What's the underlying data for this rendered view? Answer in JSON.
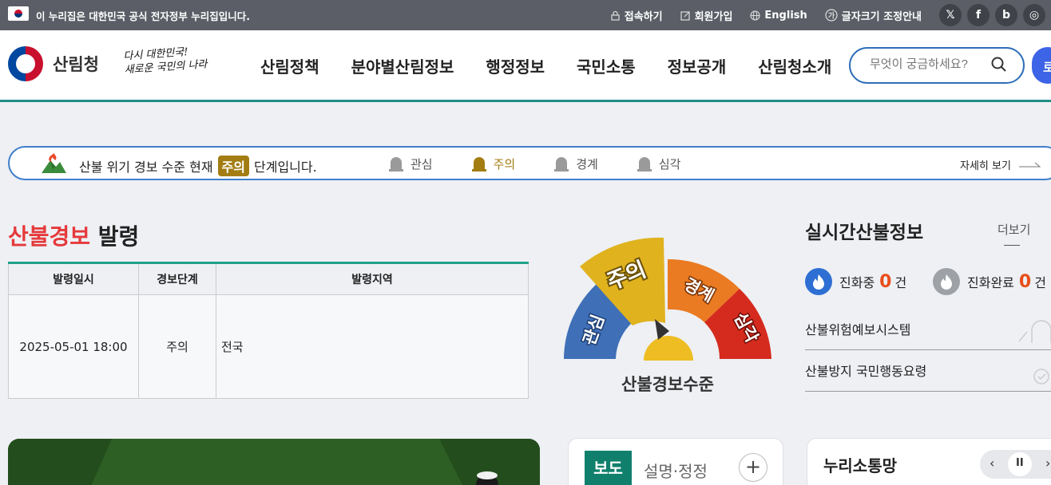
{
  "gov_bar": {
    "notice": "이 누리집은 대한민국 공식 전자정부 누리집입니다.",
    "links": [
      "접속하기",
      "회원가입",
      "English",
      "글자크기 조정안내"
    ],
    "sns": [
      "x-icon",
      "facebook-icon",
      "blog-icon",
      "instagram-icon"
    ]
  },
  "header": {
    "org_name": "산림청",
    "slogan_line1": "다시 대한민국!",
    "slogan_line2": "새로운 국민의 나라",
    "menu": [
      "산림정책",
      "분야별산림정보",
      "행정정보",
      "국민소통",
      "정보공개",
      "산림청소개"
    ],
    "search_placeholder": "무엇이 궁금하세요?",
    "side_button": "로"
  },
  "alert": {
    "msg_before": "산불 위기 경보 수준 현재",
    "current": "주의",
    "msg_after": "단계입니다.",
    "levels": [
      {
        "label": "관심",
        "active": false
      },
      {
        "label": "주의",
        "active": true
      },
      {
        "label": "경계",
        "active": false
      },
      {
        "label": "심각",
        "active": false
      }
    ],
    "more": "자세히 보기"
  },
  "warning": {
    "title_red": "산불경보",
    "title_rest": "발령",
    "headers": [
      "발령일시",
      "경보단계",
      "발령지역"
    ],
    "row": [
      "2025-05-01 18:00",
      "주의",
      "전국"
    ]
  },
  "gauge": {
    "label": "산불경보수준",
    "segments": [
      "관심",
      "주의",
      "경계",
      "심각"
    ],
    "current_level": "주의",
    "colors": {
      "관심": "#3f6fb7",
      "주의": "#e0b21e",
      "경계": "#ea7b22",
      "심각": "#d52b1e"
    }
  },
  "realtime": {
    "title": "실시간산불정보",
    "more": "더보기",
    "burning_label": "진화중",
    "burning_count": "0",
    "done_label": "진화완료",
    "done_count": "0",
    "unit": "건",
    "links": [
      "산불위험예보시스템",
      "산불방지 국민행동요령"
    ]
  },
  "cards": {
    "press_tag": "보도",
    "press_tab2": "설명·정정",
    "press_more": "+",
    "nuri_title": "누리소통망",
    "prev": "‹",
    "pause": "II",
    "next": "›"
  }
}
